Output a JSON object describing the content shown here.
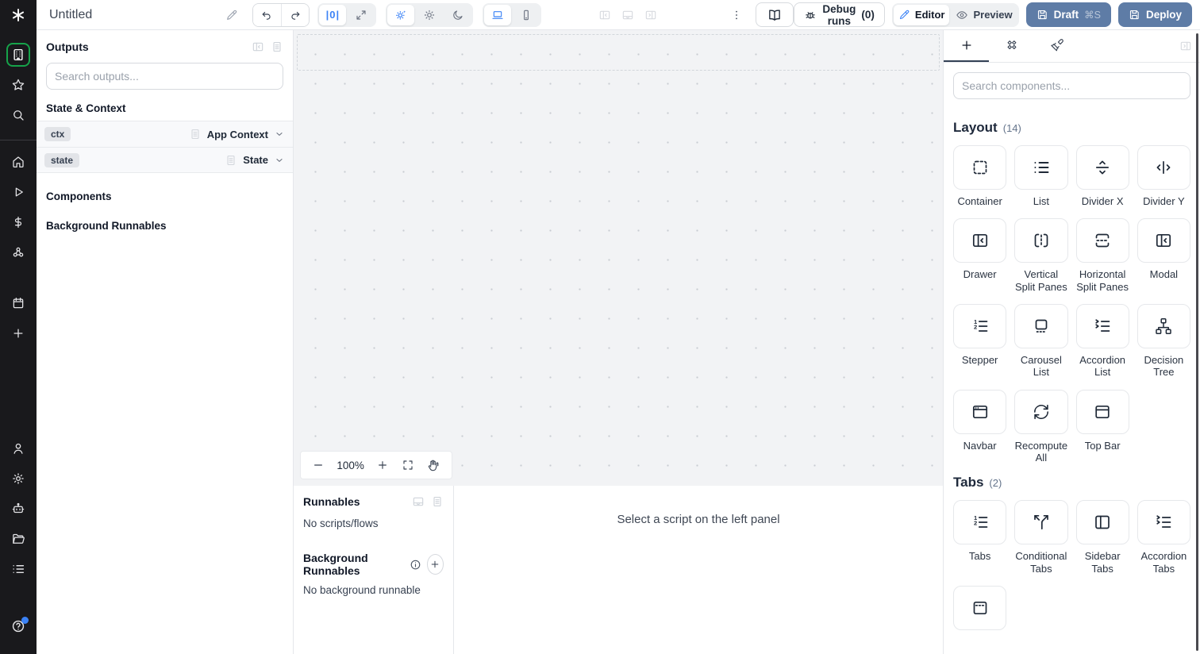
{
  "topbar": {
    "title": "Untitled",
    "debug_runs_label": "Debug runs",
    "debug_runs_count": "(0)",
    "editor_label": "Editor",
    "preview_label": "Preview",
    "draft_label": "Draft",
    "draft_shortcut": "⌘S",
    "deploy_label": "Deploy",
    "width_guide_glyph": "|0|"
  },
  "sidebar": {
    "items": [
      {
        "name": "apps",
        "icon": "building-icon",
        "active": true
      },
      {
        "name": "favorites",
        "icon": "star-icon"
      },
      {
        "name": "search",
        "icon": "search-icon"
      },
      {
        "divider": true
      },
      {
        "name": "home",
        "icon": "home-icon"
      },
      {
        "name": "runs",
        "icon": "play-icon"
      },
      {
        "name": "variables",
        "icon": "dollar-icon"
      },
      {
        "name": "resources",
        "icon": "resources-icon"
      },
      {
        "gap": 26
      },
      {
        "name": "schedules",
        "icon": "calendar-icon"
      },
      {
        "name": "add",
        "icon": "plus-icon"
      },
      {
        "spacer": true
      },
      {
        "name": "user",
        "icon": "user-icon"
      },
      {
        "name": "settings",
        "icon": "gear-icon"
      },
      {
        "name": "workers",
        "icon": "robot-icon"
      },
      {
        "name": "folders",
        "icon": "folder-icon"
      },
      {
        "name": "audit-logs",
        "icon": "list-icon"
      },
      {
        "gap": 34
      },
      {
        "name": "help",
        "icon": "help-icon",
        "badge": true
      }
    ]
  },
  "outputs": {
    "title": "Outputs",
    "search_placeholder": "Search outputs...",
    "state_context_heading": "State & Context",
    "rows": [
      {
        "badge": "ctx",
        "type": "App Context"
      },
      {
        "badge": "state",
        "type": "State"
      }
    ],
    "components_heading": "Components",
    "background_heading": "Background Runnables"
  },
  "canvas": {
    "zoom": "100%"
  },
  "runnables": {
    "title": "Runnables",
    "no_scripts": "No scripts/flows",
    "background_title": "Background Runnables",
    "no_background": "No background runnable",
    "hint": "Select a script on the left panel"
  },
  "components_panel": {
    "search_placeholder": "Search components...",
    "sections": [
      {
        "title": "Layout",
        "count": "(14)",
        "items": [
          {
            "label": "Container",
            "icon": "container-icon"
          },
          {
            "label": "List",
            "icon": "list-component-icon"
          },
          {
            "label": "Divider X",
            "icon": "divider-x-icon"
          },
          {
            "label": "Divider Y",
            "icon": "divider-y-icon"
          },
          {
            "label": "Drawer",
            "icon": "drawer-icon"
          },
          {
            "label": "Vertical Split Panes",
            "icon": "vertical-split-icon"
          },
          {
            "label": "Horizontal Split Panes",
            "icon": "horizontal-split-icon"
          },
          {
            "label": "Modal",
            "icon": "modal-icon"
          },
          {
            "label": "Stepper",
            "icon": "stepper-icon"
          },
          {
            "label": "Carousel List",
            "icon": "carousel-icon"
          },
          {
            "label": "Accordion List",
            "icon": "accordion-list-icon"
          },
          {
            "label": "Decision Tree",
            "icon": "decision-tree-icon"
          },
          {
            "label": "Navbar",
            "icon": "navbar-icon"
          },
          {
            "label": "Recompute All",
            "icon": "recompute-icon"
          },
          {
            "label": "Top Bar",
            "icon": "top-bar-icon"
          }
        ]
      },
      {
        "title": "Tabs",
        "count": "(2)",
        "items": [
          {
            "label": "Tabs",
            "icon": "tabs-icon"
          },
          {
            "label": "Conditional Tabs",
            "icon": "conditional-tabs-icon"
          },
          {
            "label": "Sidebar Tabs",
            "icon": "sidebar-tabs-icon"
          },
          {
            "label": "Accordion Tabs",
            "icon": "accordion-tabs-icon"
          },
          {
            "label": "",
            "icon": "invisible-tabs-icon"
          }
        ]
      }
    ]
  },
  "colors": {
    "accent_blue": "#3b82f6",
    "active_green": "#16a34a",
    "deploy_button": "#5e7ca6"
  }
}
